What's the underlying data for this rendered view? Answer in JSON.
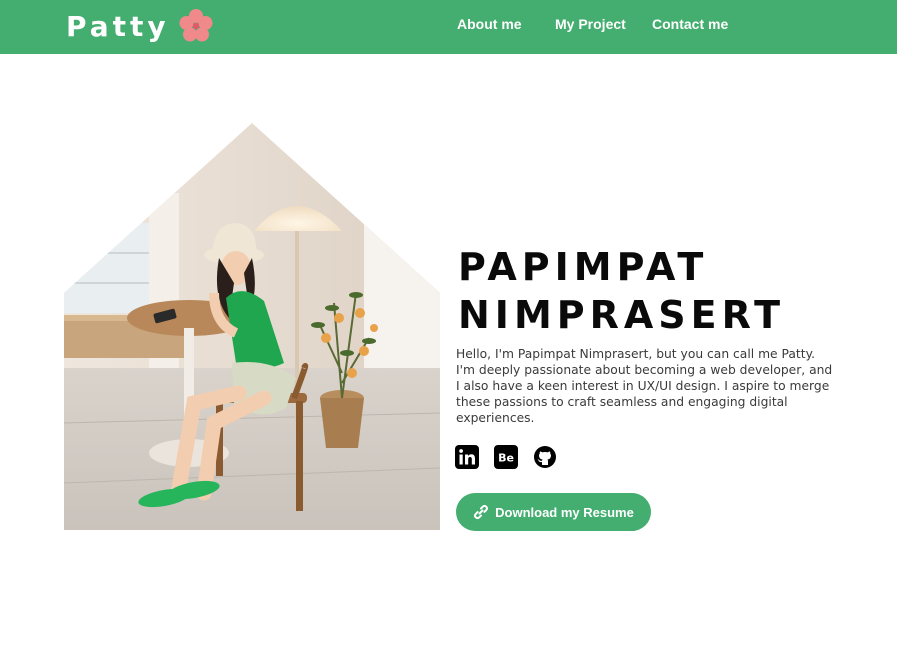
{
  "brand": {
    "name": "Patty",
    "logo_icon": "flower-icon",
    "flower_color": "#f08a8a"
  },
  "nav": {
    "items": [
      {
        "label": "About me"
      },
      {
        "label": "My Project"
      },
      {
        "label": "Contact me"
      }
    ]
  },
  "hero": {
    "name_line1": "PAPIMPAT",
    "name_line2": "NIMPRASERT",
    "bio": "Hello, I'm Papimpat Nimprasert, but you can call me Patty. I'm deeply passionate about becoming a web developer, and I also have a keen interest in UX/UI design. I aspire to merge these passions to craft seamless and engaging digital experiences.",
    "photo_icon": "profile-photo",
    "socials": [
      {
        "name": "linkedin-icon"
      },
      {
        "name": "behance-icon"
      },
      {
        "name": "github-icon"
      }
    ],
    "resume_button": {
      "label": "Download my Resume",
      "icon": "link-icon"
    }
  },
  "colors": {
    "accent": "#43ae6f",
    "text_dark": "#0a0a0a",
    "text_body": "#3a3a3a"
  }
}
